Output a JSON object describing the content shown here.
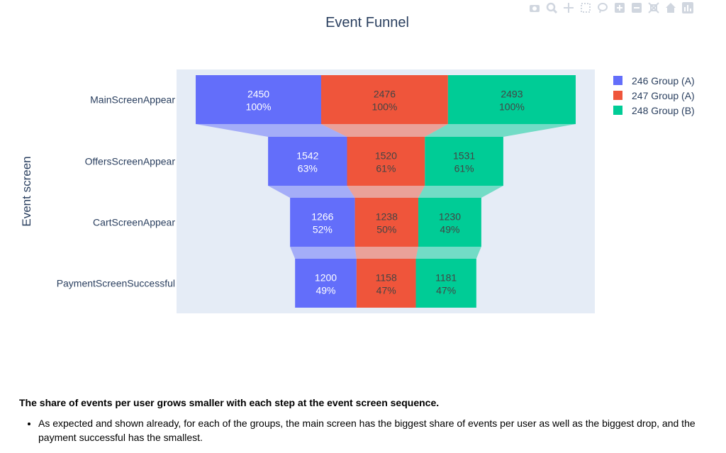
{
  "modebar": {
    "icons": [
      "camera-icon",
      "zoom-icon",
      "pan-icon",
      "box-select-icon",
      "lasso-icon",
      "zoom-in-icon",
      "zoom-out-icon",
      "autoscale-icon",
      "reset-axes-icon",
      "plotly-logo-icon"
    ]
  },
  "chart_data": {
    "type": "funnel",
    "title": "Event Funnel",
    "ylabel": "Event screen",
    "categories": [
      "MainScreenAppear",
      "OffersScreenAppear",
      "CartScreenAppear",
      "PaymentScreenSuccessful"
    ],
    "series": [
      {
        "name": "246 Group (A)",
        "color": "#636efa",
        "text_color": "#ffffff",
        "values": [
          2450,
          1542,
          1266,
          1200
        ],
        "percent": [
          "100%",
          "63%",
          "52%",
          "49%"
        ]
      },
      {
        "name": "247 Group (A)",
        "color": "#ef553b",
        "text_color": "#444444",
        "values": [
          2476,
          1520,
          1238,
          1158
        ],
        "percent": [
          "100%",
          "61%",
          "50%",
          "47%"
        ]
      },
      {
        "name": "248 Group (B)",
        "color": "#00cc96",
        "text_color": "#444444",
        "values": [
          2493,
          1531,
          1230,
          1181
        ],
        "percent": [
          "100%",
          "61%",
          "49%",
          "47%"
        ]
      }
    ],
    "legend_position": "top-right",
    "plot_bgcolor": "#e5ecf6"
  },
  "notes": {
    "heading": "The share of events per user grows smaller with each step at the event screen sequence.",
    "bullets": [
      "As expected and shown already, for each of the groups, the main screen has the biggest share of events per user as well as the biggest drop, and the payment successful has the smallest."
    ]
  }
}
